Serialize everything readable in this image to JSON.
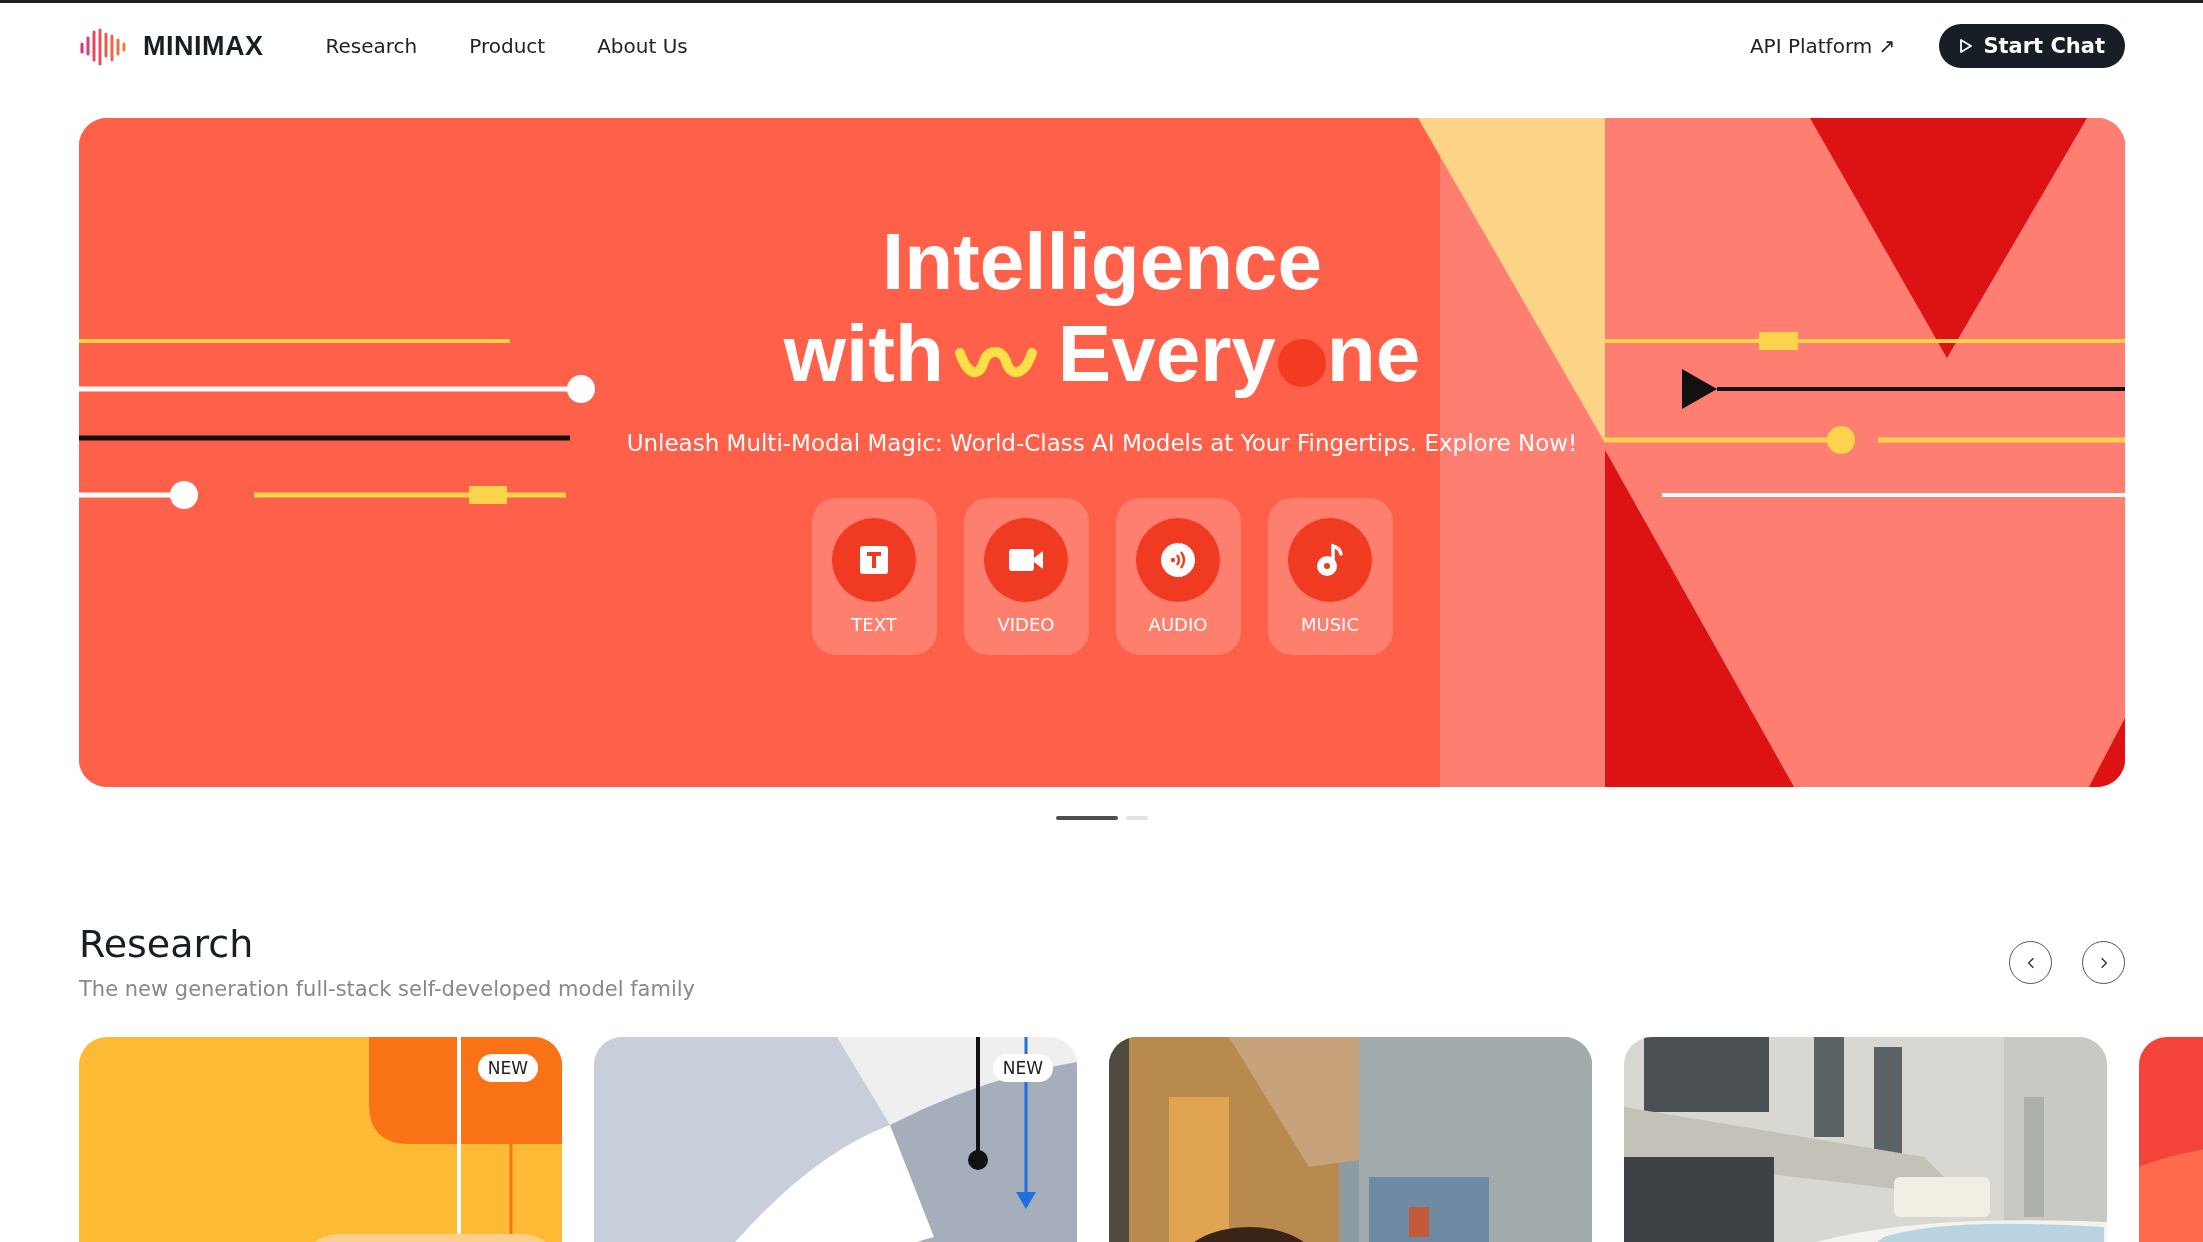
{
  "header": {
    "logo": "MINIMAX",
    "nav": [
      {
        "label": "Research"
      },
      {
        "label": "Product"
      },
      {
        "label": "About Us"
      }
    ],
    "api_link": "API Platform",
    "arrow": "↗",
    "cta": "Start Chat"
  },
  "hero": {
    "title_line1": "Intelligence",
    "title_with": "with",
    "title_word_start": "Every",
    "title_word_end": "ne",
    "subtitle": "Unleash Multi-Modal Magic: World-Class AI Models at Your Fingertips. Explore Now!",
    "modes": [
      {
        "kind": "text",
        "label": "TEXT"
      },
      {
        "kind": "video",
        "label": "VIDEO"
      },
      {
        "kind": "audio",
        "label": "AUDIO"
      },
      {
        "kind": "music",
        "label": "MUSIC"
      }
    ],
    "slides": [
      {
        "selected": true
      },
      {
        "selected": false
      }
    ]
  },
  "research": {
    "title": "Research",
    "subtitle": "The new generation full-stack self-developed model family",
    "cards": [
      {
        "kind": "art-orange",
        "badge": "NEW"
      },
      {
        "kind": "art-grey",
        "badge": "NEW"
      },
      {
        "kind": "picture"
      },
      {
        "kind": "picture"
      },
      {
        "kind": "art-red"
      }
    ]
  }
}
